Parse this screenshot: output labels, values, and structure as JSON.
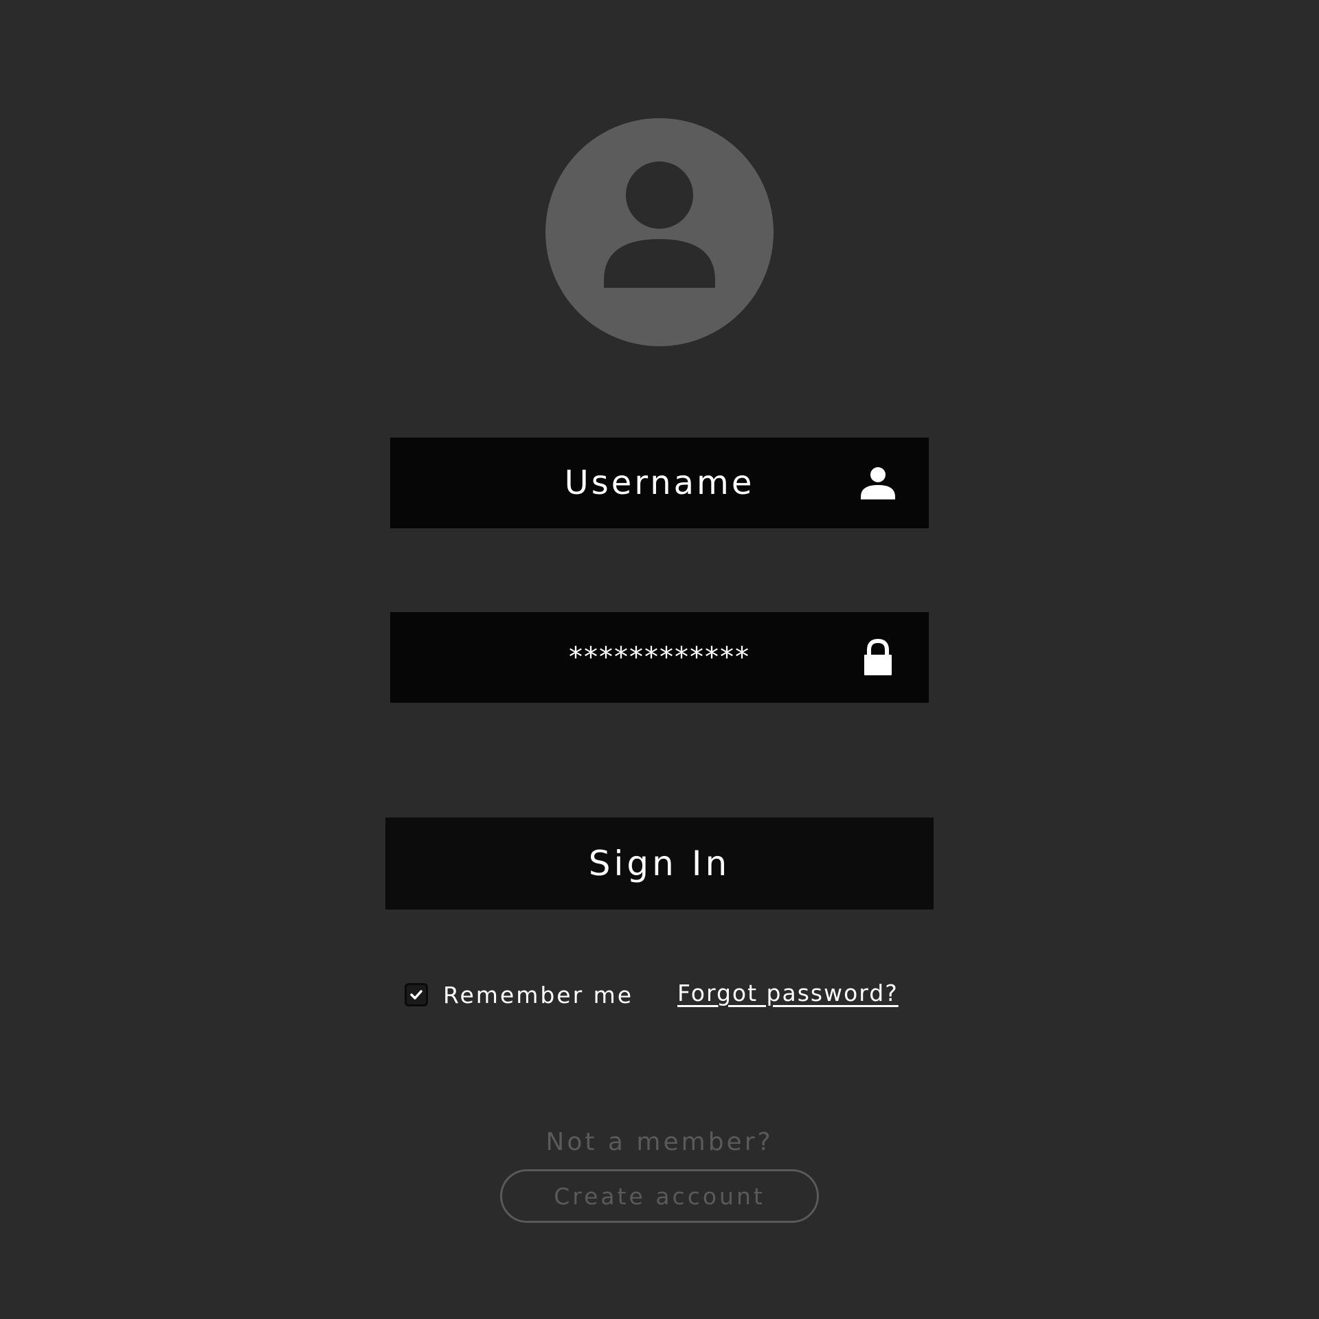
{
  "avatar": {
    "icon": "user-avatar-icon"
  },
  "username_field": {
    "value": "",
    "placeholder": "Username",
    "icon": "user-icon"
  },
  "password_field": {
    "value": "************",
    "icon": "lock-icon"
  },
  "sign_in": {
    "label": "Sign In"
  },
  "remember_me": {
    "label": "Remember me",
    "checked": true
  },
  "forgot_password": {
    "label": "Forgot password?"
  },
  "footer": {
    "prompt": "Not a member?",
    "create_account_label": "Create account"
  },
  "colors": {
    "background": "#2b2b2b",
    "field": "#060606",
    "avatar": "#5c5c5c",
    "muted": "#5a5a5a",
    "text": "#ffffff"
  }
}
